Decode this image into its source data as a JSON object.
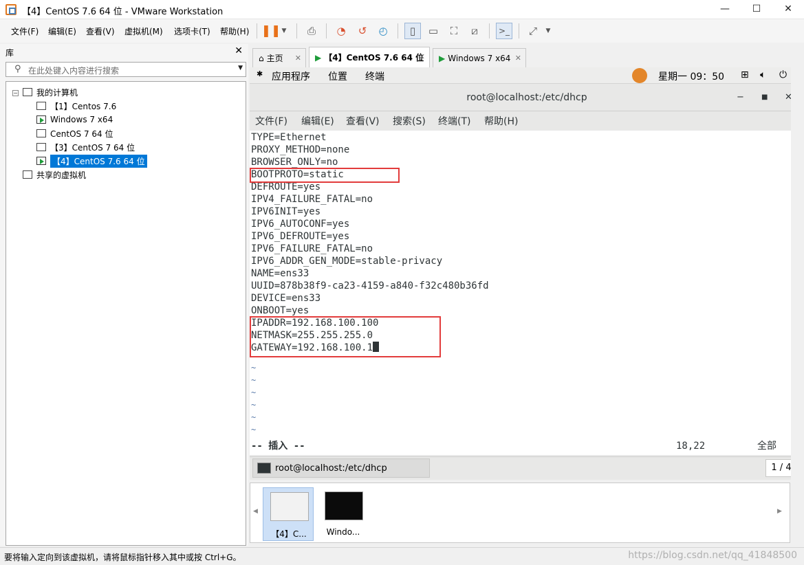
{
  "window": {
    "title": "【4】CentOS 7.6 64 位 - VMware Workstation",
    "minimize": "—",
    "maximize": "☐",
    "close": "✕"
  },
  "menu": {
    "file": "文件(F)",
    "edit": "编辑(E)",
    "view": "查看(V)",
    "vm": "虚拟机(M)",
    "tabs": "选项卡(T)",
    "help": "帮助(H)"
  },
  "library": {
    "title": "库",
    "close": "✕",
    "search_placeholder": "在此处键入内容进行搜索",
    "root": "我的计算机",
    "items": [
      "【1】Centos 7.6",
      "Windows 7 x64",
      "CentOS 7 64 位",
      "【3】CentOS 7 64 位",
      "【4】CentOS 7.6 64 位"
    ],
    "shared": "共享的虚拟机"
  },
  "tabs": [
    {
      "label": "主页"
    },
    {
      "label": "【4】CentOS 7.6 64 位"
    },
    {
      "label": "Windows 7 x64"
    }
  ],
  "gnome": {
    "apps": "应用程序",
    "places": "位置",
    "terminal": "终端",
    "clock": "星期一 09：50"
  },
  "terminal": {
    "title": "root@localhost:/etc/dhcp",
    "menu": [
      "文件(F)",
      "编辑(E)",
      "查看(V)",
      "搜索(S)",
      "终端(T)",
      "帮助(H)"
    ],
    "lines": [
      "TYPE=Ethernet",
      "PROXY_METHOD=none",
      "BROWSER_ONLY=no",
      "BOOTPROTO=static",
      "DEFROUTE=yes",
      "IPV4_FAILURE_FATAL=no",
      "IPV6INIT=yes",
      "IPV6_AUTOCONF=yes",
      "IPV6_DEFROUTE=yes",
      "IPV6_FAILURE_FATAL=no",
      "IPV6_ADDR_GEN_MODE=stable-privacy",
      "NAME=ens33",
      "UUID=878b38f9-ca23-4159-a840-f32c480b36fd",
      "DEVICE=ens33",
      "ONBOOT=yes",
      "IPADDR=192.168.100.100",
      "NETMASK=255.255.255.0",
      "GATEWAY=192.168.100.1"
    ],
    "tilde": "~",
    "mode": "-- 插入 --",
    "position": "18,22",
    "scroll_all": "全部",
    "taskbar_label": "root@localhost:/etc/dhcp",
    "pager": "1 / 4"
  },
  "thumbnails": [
    {
      "label": "【4】C..."
    },
    {
      "label": "Windo..."
    }
  ],
  "status": {
    "message": "要将输入定向到该虚拟机，请将鼠标指针移入其中或按 Ctrl+G。",
    "watermark": "https://blog.csdn.net/qq_41848500"
  }
}
